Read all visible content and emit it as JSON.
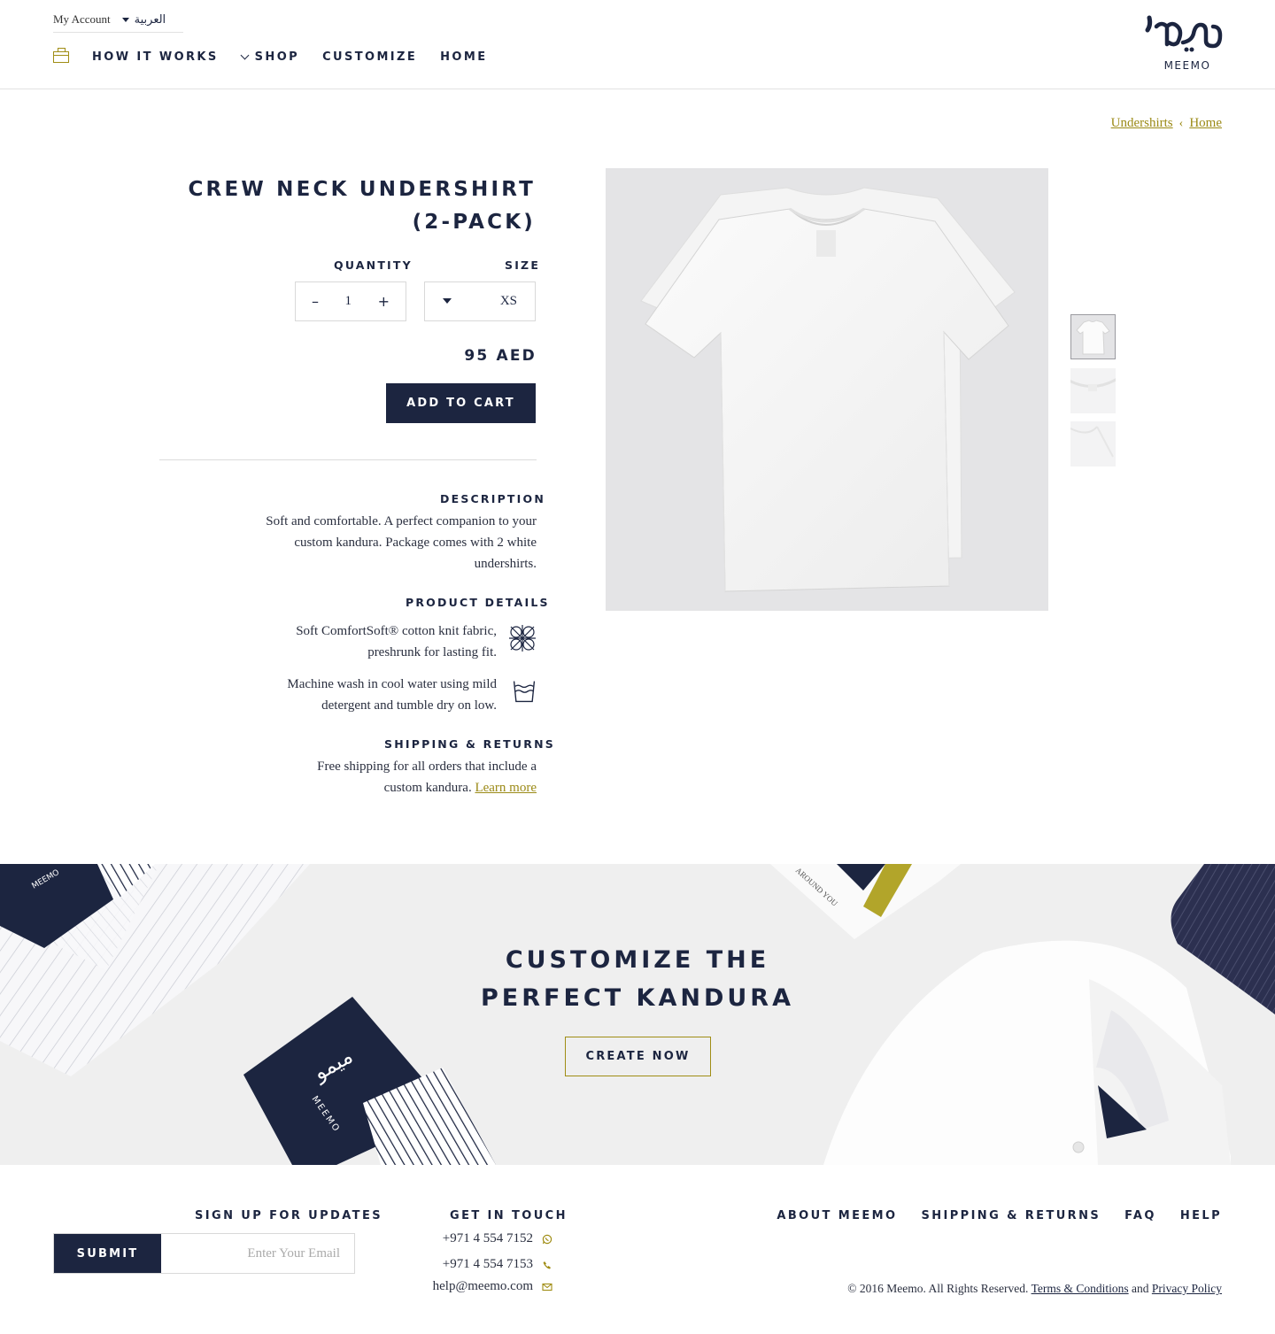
{
  "header": {
    "my_account": "My Account",
    "language": "العربية",
    "nav": {
      "how_it_works": "HOW IT WORKS",
      "shop": "SHOP",
      "customize": "CUSTOMIZE",
      "home": "HOME"
    },
    "logo_text": "MEEMO",
    "logo_arabic": "ميمو"
  },
  "breadcrumb": {
    "category": "Undershirts",
    "home": "Home"
  },
  "product": {
    "title_line1": "CREW NECK UNDERSHIRT",
    "title_line2": "(2-PACK)",
    "quantity_label": "QUANTITY",
    "quantity_value": "1",
    "quantity_minus": "–",
    "quantity_plus": "+",
    "size_label": "SIZE",
    "size_value": "XS",
    "price": "95 AED",
    "add_to_cart": "ADD TO CART",
    "description_label": "DESCRIPTION",
    "description": "Soft and comfortable. A perfect companion to your custom kandura. Package comes with 2 white undershirts.",
    "details_label": "PRODUCT DETAILS",
    "detail_1": "Soft ComfortSoft® cotton knit fabric, preshrunk for lasting fit.",
    "detail_2": "Machine wash in cool water using mild detergent and tumble dry on low.",
    "shipping_label": "SHIPPING & RETURNS",
    "shipping_text": "Free shipping for all orders that include a custom kandura.",
    "learn_more": "Learn more",
    "thumbnails": 3,
    "active_thumbnail": 1
  },
  "banner": {
    "title_line1": "CUSTOMIZE THE",
    "title_line2": "PERFECT KANDURA",
    "button": "CREATE NOW",
    "card_text": "MEEMO",
    "card_arabic": "ميمو",
    "tag_text": "AROUND YOU"
  },
  "footer": {
    "signup_label": "SIGN UP FOR UPDATES",
    "submit": "SUBMIT",
    "email_placeholder": "Enter Your Email",
    "contact_label": "GET IN TOUCH",
    "whatsapp": "+971 4 554 7152",
    "phone": "+971 4 554 7153",
    "email": "help@meemo.com",
    "links": {
      "about": "ABOUT MEEMO",
      "shipping": "SHIPPING & RETURNS",
      "faq": "FAQ",
      "help": "HELP"
    },
    "copyright": "© 2016 Meemo. All Rights Reserved.",
    "terms": "Terms & Conditions",
    "and": "and",
    "privacy": "Privacy Policy"
  },
  "colors": {
    "navy": "#1c2540",
    "gold": "#a08d15",
    "banner_bg": "#efefef"
  }
}
